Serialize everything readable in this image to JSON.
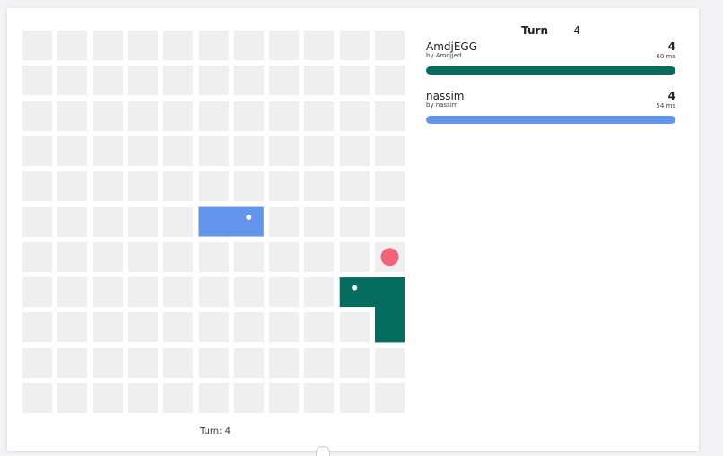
{
  "game": {
    "turn_label": "Turn",
    "turn": "4",
    "footer_turn": "Turn: 4",
    "board_width": 11,
    "board_height": 11,
    "food": [
      [
        10,
        6
      ]
    ],
    "snakes": [
      {
        "name": "AmdjEGG",
        "author": "by Amdjjed",
        "length": "4",
        "latency": "60 ms",
        "color": "#046d5f",
        "health": 100,
        "body": [
          [
            9,
            7
          ],
          [
            10,
            7
          ],
          [
            10,
            8
          ],
          [
            10,
            8
          ]
        ]
      },
      {
        "name": "nassim",
        "author": "by nassim",
        "length": "4",
        "latency": "54 ms",
        "color": "#6495ed",
        "health": 100,
        "body": [
          [
            6,
            5
          ],
          [
            5,
            5
          ],
          [
            5,
            5
          ],
          [
            5,
            5
          ]
        ]
      }
    ]
  },
  "colors": {
    "cell": "#efefef",
    "food": "#f0657a",
    "background": "#ffffff"
  }
}
